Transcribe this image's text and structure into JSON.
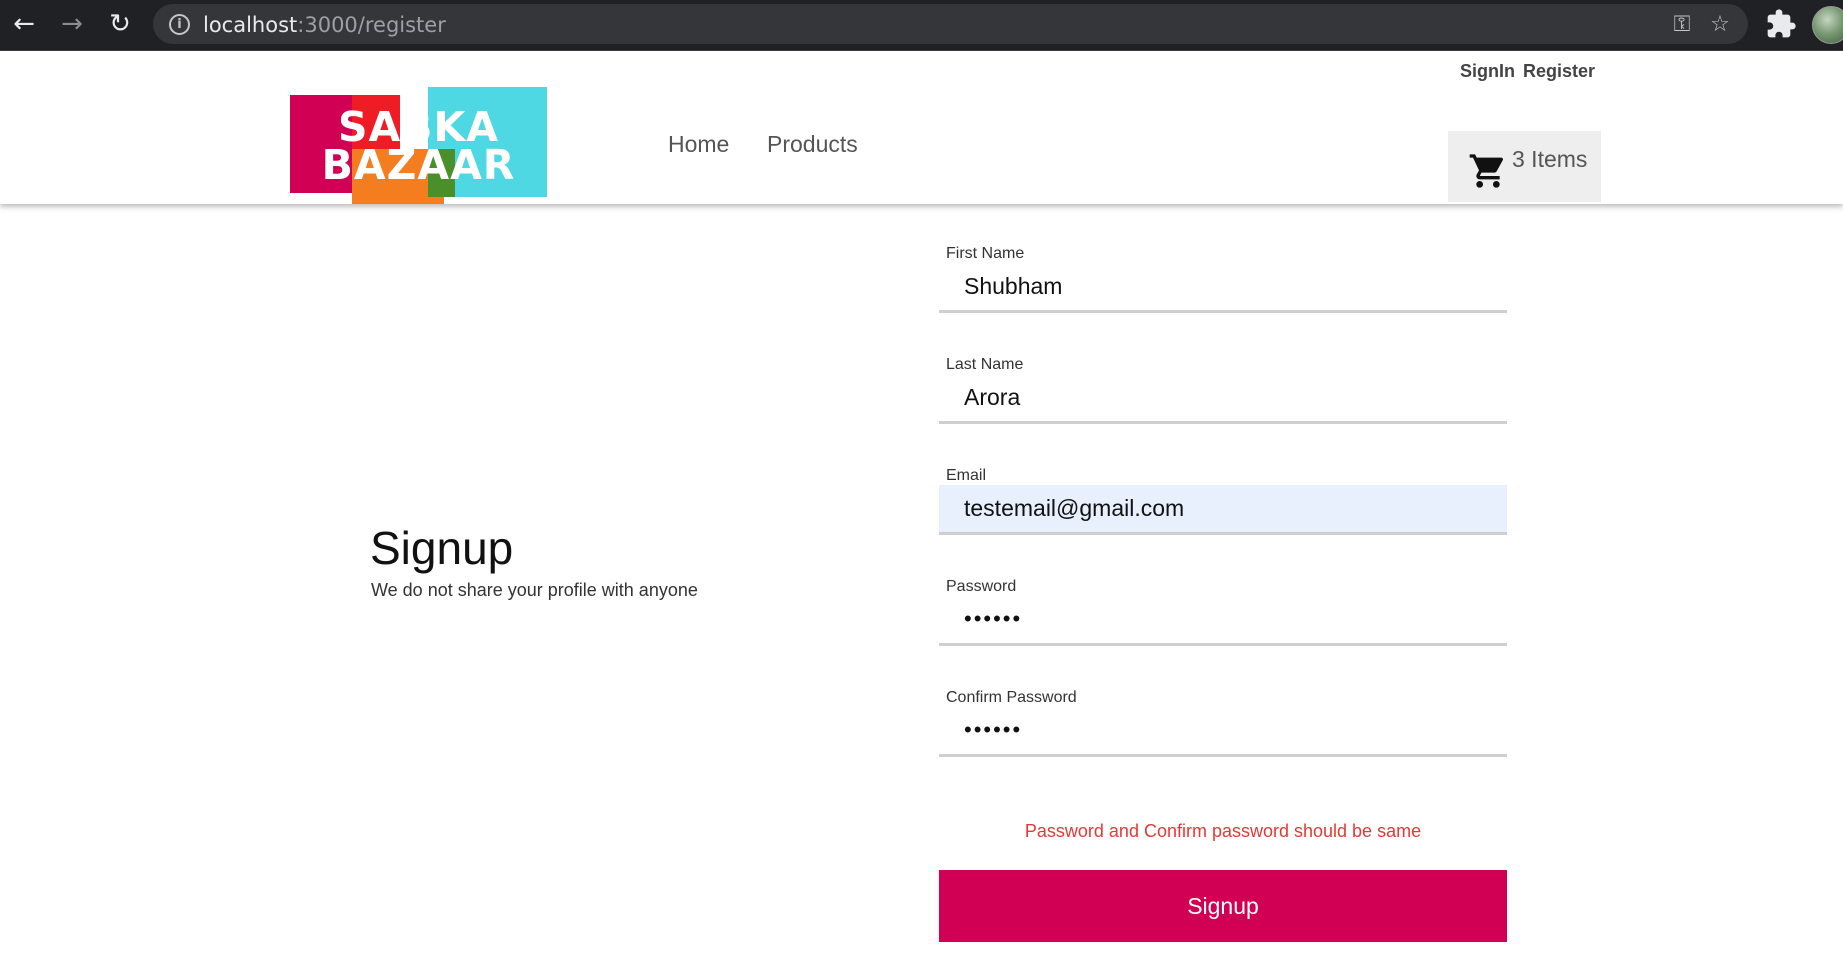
{
  "browser": {
    "url_host": "localhost",
    "url_path": ":3000/register",
    "back_icon": "←",
    "forward_icon": "→",
    "reload_icon": "↻",
    "info_icon": "i",
    "key_icon": "⚿",
    "star_icon": "☆"
  },
  "header": {
    "logo": {
      "line1": "SABKA",
      "line2": "BAZAAR"
    },
    "nav": [
      "Home",
      "Products"
    ],
    "auth": {
      "signin": "SignIn",
      "register": "Register"
    },
    "cart": {
      "label": "3 Items",
      "count": 3
    }
  },
  "page": {
    "title": "Signup",
    "subtitle": "We do not share your profile with anyone"
  },
  "form": {
    "fields": [
      {
        "label": "First Name",
        "value": "Shubham"
      },
      {
        "label": "Last Name",
        "value": "Arora"
      },
      {
        "label": "Email",
        "value": "testemail@gmail.com",
        "autofilled": true
      },
      {
        "label": "Password",
        "value": "••••••",
        "masked": true
      },
      {
        "label": "Confirm Password",
        "value": "••••••",
        "masked": true
      }
    ],
    "error": "Password and Confirm password should be same",
    "submit_label": "Signup"
  },
  "colors": {
    "accent": "#d10054",
    "error": "#e53935",
    "autofill_bg": "#e8f0fe"
  }
}
